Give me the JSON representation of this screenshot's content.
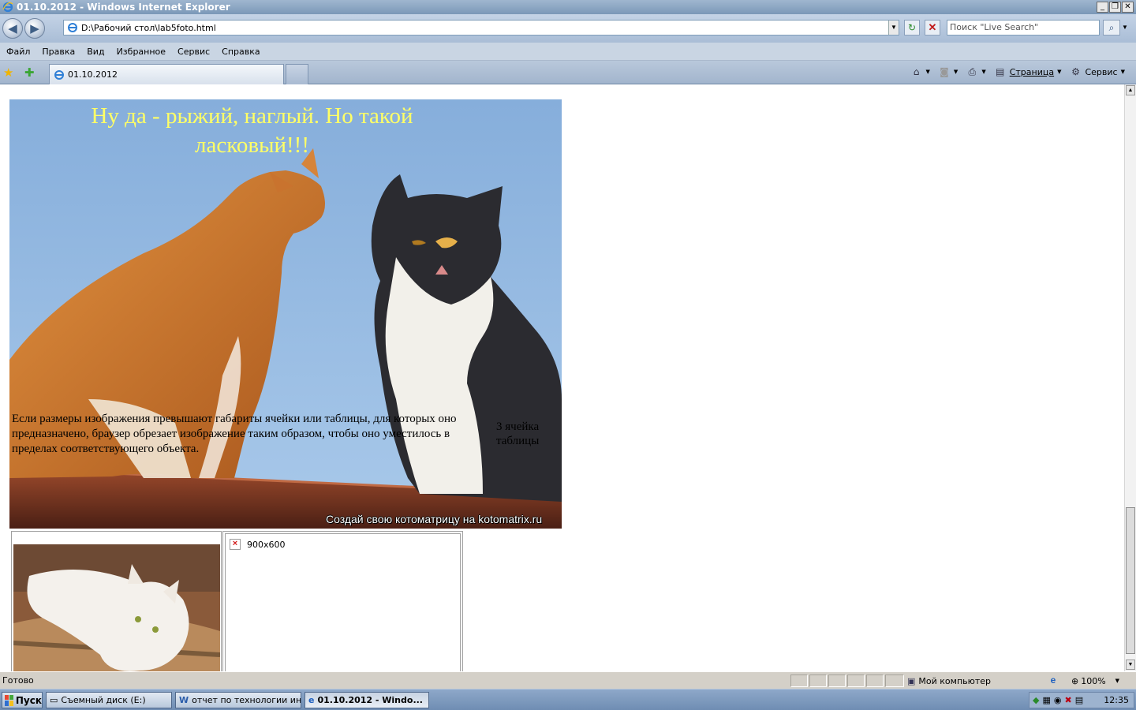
{
  "window": {
    "title": "01.10.2012 - Windows Internet Explorer",
    "buttons": {
      "minimize": "_",
      "restore": "❐",
      "close": "✕"
    }
  },
  "toolbar": {
    "back": "◀",
    "forward": "▶",
    "address": "D:\\Рабочий стол\\lab5foto.html",
    "search_placeholder": "Поиск \"Live Search\"",
    "refresh": "↻",
    "stop": "✕",
    "search_btn": "⌕"
  },
  "menu": [
    "Файл",
    "Правка",
    "Вид",
    "Избранное",
    "Сервис",
    "Справка"
  ],
  "tabs": [
    {
      "label": "01.10.2012"
    }
  ],
  "command_bar": {
    "page": "Страница",
    "tools": "Сервис"
  },
  "page": {
    "heading": "Ну да - рыжий, наглый. Но такой ласковый!!!",
    "cell_text": "Если размеры изображения превышают габариты ячейки или таблицы, для которых оно предназначено, браузер обрезает изображение таким образом, чтобы оно уместилось в пределах соответствующего объекта.",
    "cell3_text": "3 ячейка таблицы",
    "watermark": "Создай свою котоматрицу на kotomatrix.ru",
    "broken_image_alt": "900x600"
  },
  "statusbar": {
    "status": "Готово",
    "zone": "Мой компьютер",
    "zoom": "100%"
  },
  "taskbar": {
    "start": "Пуск",
    "items": [
      {
        "label": "Съемный диск (E:)"
      },
      {
        "label": "отчет по технологии инт..."
      },
      {
        "label": "01.10.2012 - Windo..."
      }
    ],
    "clock": "12:35"
  },
  "colors": {
    "heading": "#ffff66",
    "titlebar": "#7b98b8",
    "sky": "#8fb6de",
    "roof": "#8a3a22"
  }
}
